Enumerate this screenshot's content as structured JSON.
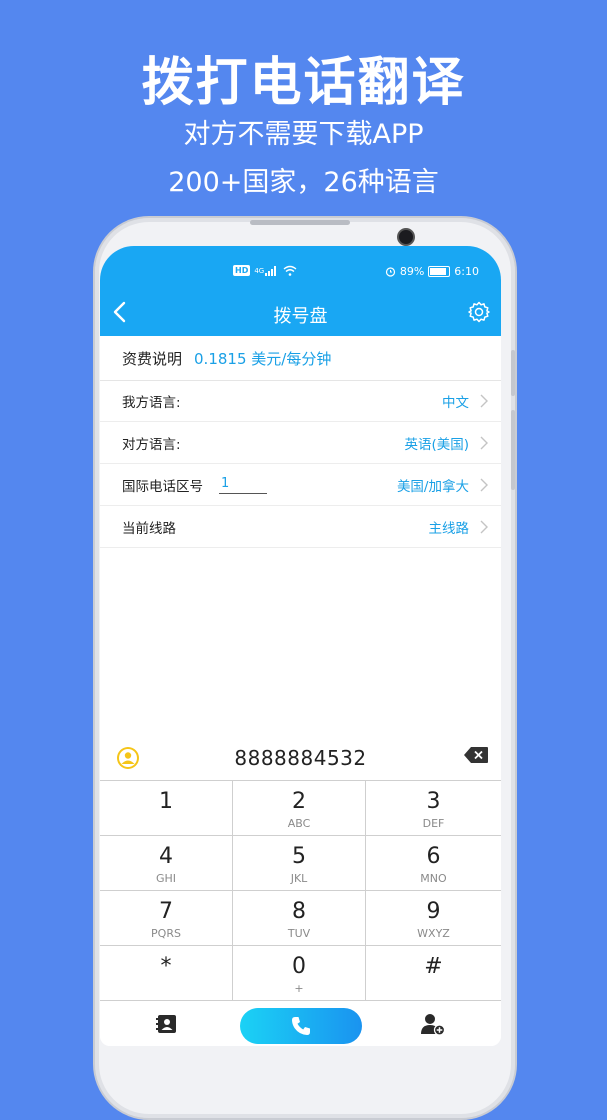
{
  "promo": {
    "title": "拨打电话翻译",
    "line1": "对方不需要下载APP",
    "line2": "200+国家，26种语言"
  },
  "status": {
    "hd": "HD",
    "network": "4G",
    "battery": "89%",
    "battery_level": 0.89,
    "time": "6:10"
  },
  "app": {
    "title": "拨号盘"
  },
  "rate": {
    "label": "资费说明",
    "value": "0.1815 美元/每分钟"
  },
  "settings": {
    "my_language_label": "我方语言:",
    "my_language_value": "中文",
    "other_language_label": "对方语言:",
    "other_language_value": "英语(美国)",
    "country_code_label": "国际电话区号",
    "country_code_value": "1",
    "country_name": "美国/加拿大",
    "line_label": "当前线路",
    "line_value": "主线路"
  },
  "dialer": {
    "number": "8888884532",
    "keys": [
      {
        "digit": "1",
        "letters": ""
      },
      {
        "digit": "2",
        "letters": "ABC"
      },
      {
        "digit": "3",
        "letters": "DEF"
      },
      {
        "digit": "4",
        "letters": "GHI"
      },
      {
        "digit": "5",
        "letters": "JKL"
      },
      {
        "digit": "6",
        "letters": "MNO"
      },
      {
        "digit": "7",
        "letters": "PQRS"
      },
      {
        "digit": "8",
        "letters": "TUV"
      },
      {
        "digit": "9",
        "letters": "WXYZ"
      },
      {
        "digit": "*",
        "letters": ""
      },
      {
        "digit": "0",
        "letters": "+"
      },
      {
        "digit": "#",
        "letters": ""
      }
    ]
  },
  "colors": {
    "background": "#5487ef",
    "app_bar": "#19a7f3",
    "accent_text": "#1aa0e6",
    "contact_icon": "#f5c518"
  }
}
